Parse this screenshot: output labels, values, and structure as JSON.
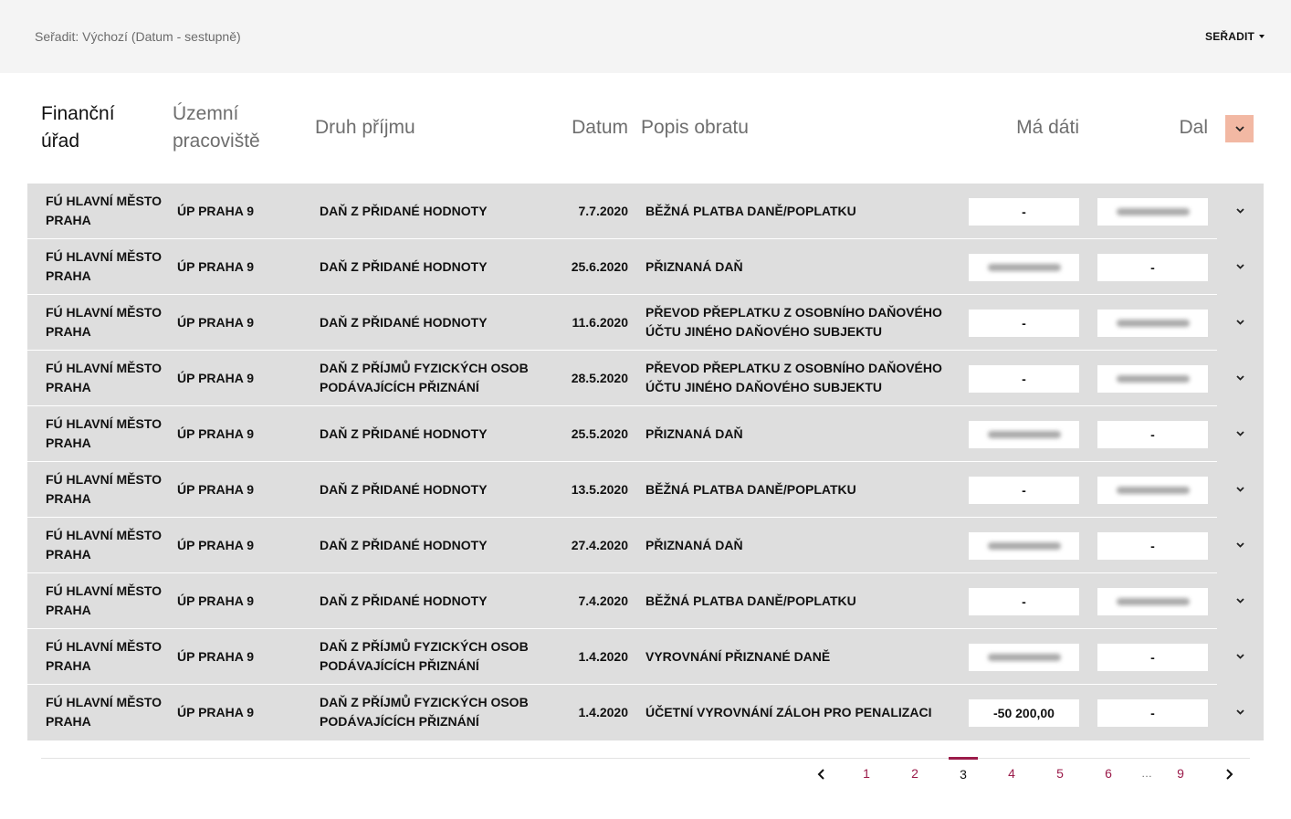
{
  "sort": {
    "label": "Seřadit: Výchozí (Datum - sestupně)",
    "button": "SEŘADIT"
  },
  "headers": {
    "financni_urad_line1": "Finanční",
    "financni_urad_line2": "úřad",
    "uzemni_line1": "Územní",
    "uzemni_line2": "pracoviště",
    "druh": "Druh příjmu",
    "datum": "Datum",
    "popis": "Popis obratu",
    "ma_dati": "Má dáti",
    "dal": "Dal"
  },
  "rows": [
    {
      "fu1": "FÚ HLAVNÍ MĚSTO",
      "fu2": "PRAHA",
      "up": "ÚP PRAHA 9",
      "druh1": "DAŇ Z PŘIDANÉ HODNOTY",
      "druh2": "",
      "datum": "7.7.2020",
      "popis1": "BĚŽNÁ PLATBA DANĚ/POPLATKU",
      "popis2": "",
      "ma_dati": "-",
      "dal": ""
    },
    {
      "fu1": "FÚ HLAVNÍ MĚSTO",
      "fu2": "PRAHA",
      "up": "ÚP PRAHA 9",
      "druh1": "DAŇ Z PŘIDANÉ HODNOTY",
      "druh2": "",
      "datum": "25.6.2020",
      "popis1": "PŘIZNANÁ DAŇ",
      "popis2": "",
      "ma_dati": "",
      "dal": "-"
    },
    {
      "fu1": "FÚ HLAVNÍ MĚSTO",
      "fu2": "PRAHA",
      "up": "ÚP PRAHA 9",
      "druh1": "DAŇ Z PŘIDANÉ HODNOTY",
      "druh2": "",
      "datum": "11.6.2020",
      "popis1": "PŘEVOD PŘEPLATKU Z OSOBNÍHO DAŇOVÉHO",
      "popis2": "ÚČTU JINÉHO DAŇOVÉHO SUBJEKTU",
      "ma_dati": "-",
      "dal": ""
    },
    {
      "fu1": "FÚ HLAVNÍ MĚSTO",
      "fu2": "PRAHA",
      "up": "ÚP PRAHA 9",
      "druh1": "DAŇ Z PŘÍJMŮ FYZICKÝCH OSOB",
      "druh2": "PODÁVAJÍCÍCH PŘIZNÁNÍ",
      "datum": "28.5.2020",
      "popis1": "PŘEVOD PŘEPLATKU Z OSOBNÍHO DAŇOVÉHO",
      "popis2": "ÚČTU JINÉHO DAŇOVÉHO SUBJEKTU",
      "ma_dati": "-",
      "dal": ""
    },
    {
      "fu1": "FÚ HLAVNÍ MĚSTO",
      "fu2": "PRAHA",
      "up": "ÚP PRAHA 9",
      "druh1": "DAŇ Z PŘIDANÉ HODNOTY",
      "druh2": "",
      "datum": "25.5.2020",
      "popis1": "PŘIZNANÁ DAŇ",
      "popis2": "",
      "ma_dati": "",
      "dal": "-"
    },
    {
      "fu1": "FÚ HLAVNÍ MĚSTO",
      "fu2": "PRAHA",
      "up": "ÚP PRAHA 9",
      "druh1": "DAŇ Z PŘIDANÉ HODNOTY",
      "druh2": "",
      "datum": "13.5.2020",
      "popis1": "BĚŽNÁ PLATBA DANĚ/POPLATKU",
      "popis2": "",
      "ma_dati": "-",
      "dal": ""
    },
    {
      "fu1": "FÚ HLAVNÍ MĚSTO",
      "fu2": "PRAHA",
      "up": "ÚP PRAHA 9",
      "druh1": "DAŇ Z PŘIDANÉ HODNOTY",
      "druh2": "",
      "datum": "27.4.2020",
      "popis1": "PŘIZNANÁ DAŇ",
      "popis2": "",
      "ma_dati": "",
      "dal": "-"
    },
    {
      "fu1": "FÚ HLAVNÍ MĚSTO",
      "fu2": "PRAHA",
      "up": "ÚP PRAHA 9",
      "druh1": "DAŇ Z PŘIDANÉ HODNOTY",
      "druh2": "",
      "datum": "7.4.2020",
      "popis1": "BĚŽNÁ PLATBA DANĚ/POPLATKU",
      "popis2": "",
      "ma_dati": "-",
      "dal": ""
    },
    {
      "fu1": "FÚ HLAVNÍ MĚSTO",
      "fu2": "PRAHA",
      "up": "ÚP PRAHA 9",
      "druh1": "DAŇ Z PŘÍJMŮ FYZICKÝCH OSOB",
      "druh2": "PODÁVAJÍCÍCH PŘIZNÁNÍ",
      "datum": "1.4.2020",
      "popis1": "VYROVNÁNÍ PŘIZNANÉ DANĚ",
      "popis2": "",
      "ma_dati": "",
      "dal": "-"
    },
    {
      "fu1": "FÚ HLAVNÍ MĚSTO",
      "fu2": "PRAHA",
      "up": "ÚP PRAHA 9",
      "druh1": "DAŇ Z PŘÍJMŮ FYZICKÝCH OSOB",
      "druh2": "PODÁVAJÍCÍCH PŘIZNÁNÍ",
      "datum": "1.4.2020",
      "popis1": "ÚČETNÍ VYROVNÁNÍ ZÁLOH PRO PENALIZACI",
      "popis2": "",
      "ma_dati": "-50 200,00",
      "dal": "-"
    }
  ],
  "pagination": {
    "pages": [
      "1",
      "2",
      "3",
      "4",
      "5",
      "6",
      "…",
      "9"
    ],
    "current": "3",
    "accent_color": "#9b1b4a"
  },
  "colors": {
    "topbar": "#f4f4f4",
    "table_bg": "#dedede",
    "expand_button": "#f2b8a3"
  },
  "icons": {
    "row_toggle": "chevron-down-icon",
    "prev": "chevron-left-icon",
    "next": "chevron-right-icon"
  }
}
